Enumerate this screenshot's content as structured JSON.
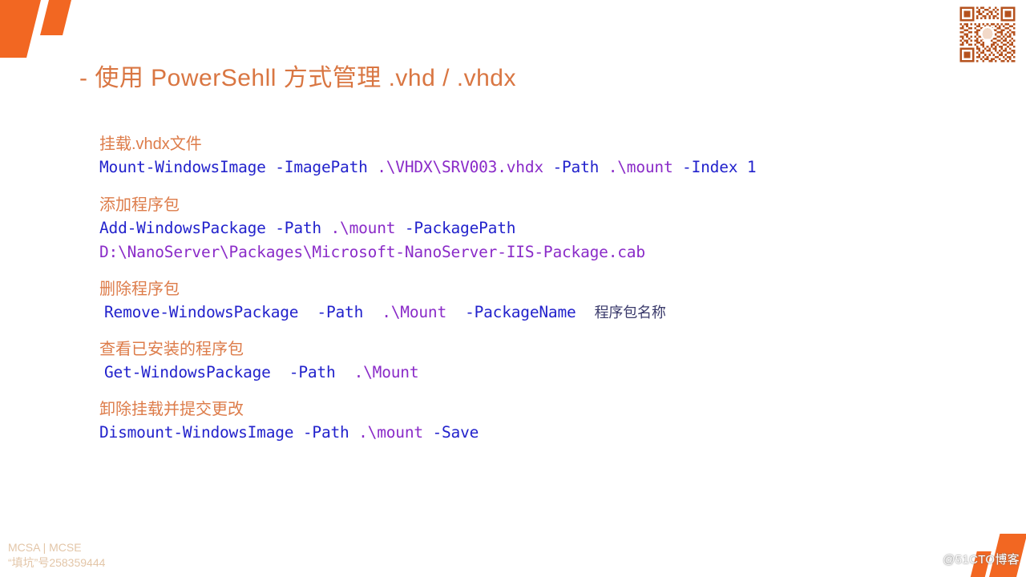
{
  "slide": {
    "title": "- 使用 PowerSehll 方式管理 .vhd / .vhdx",
    "accent_color": "#F26722",
    "heading_color": "#DD7C4A",
    "command_color": "#2222CC",
    "path_color": "#8A2BC8"
  },
  "blocks": [
    {
      "heading": "挂载.vhdx文件",
      "lines": [
        {
          "segments": [
            {
              "text": "Mount-WindowsImage -ImagePath ",
              "type": "cmd"
            },
            {
              "text": ".\\VHDX\\SRV003.vhdx",
              "type": "path"
            },
            {
              "text": " -Path ",
              "type": "cmd"
            },
            {
              "text": ".\\mount",
              "type": "path"
            },
            {
              "text": " -Index 1",
              "type": "cmd"
            }
          ]
        }
      ]
    },
    {
      "heading": "添加程序包",
      "lines": [
        {
          "segments": [
            {
              "text": "Add-WindowsPackage -Path ",
              "type": "cmd"
            },
            {
              "text": ".\\mount",
              "type": "path"
            },
            {
              "text": " -PackagePath",
              "type": "cmd"
            }
          ]
        },
        {
          "segments": [
            {
              "text": "D:\\NanoServer\\Packages\\Microsoft-NanoServer-IIS-Package.cab",
              "type": "path"
            }
          ]
        }
      ]
    },
    {
      "heading": "删除程序包",
      "indent": true,
      "lines": [
        {
          "segments": [
            {
              "text": "Remove-WindowsPackage  -Path  ",
              "type": "cmd"
            },
            {
              "text": ".\\Mount",
              "type": "path"
            },
            {
              "text": "  -PackageName  ",
              "type": "cmd"
            },
            {
              "text": "程序包名称",
              "type": "cn"
            }
          ]
        }
      ]
    },
    {
      "heading": "查看已安装的程序包",
      "indent": true,
      "lines": [
        {
          "segments": [
            {
              "text": "Get-WindowsPackage  -Path  ",
              "type": "cmd"
            },
            {
              "text": ".\\Mount",
              "type": "path"
            }
          ]
        }
      ]
    },
    {
      "heading": "卸除挂载并提交更改",
      "lines": [
        {
          "segments": [
            {
              "text": "Dismount-WindowsImage -Path ",
              "type": "cmd"
            },
            {
              "text": ".\\mount",
              "type": "path"
            },
            {
              "text": " -Save",
              "type": "cmd"
            }
          ]
        }
      ]
    }
  ],
  "footer": {
    "line1": "MCSA | MCSE",
    "line2": "“填坑”号258359444"
  },
  "watermark": {
    "text": "@51CTO博客"
  },
  "decorations": {
    "qr_code": "qr-code-icon",
    "top_left_mark": "quote-mark-decoration",
    "bottom_right_mark": "corner-mark-decoration"
  }
}
